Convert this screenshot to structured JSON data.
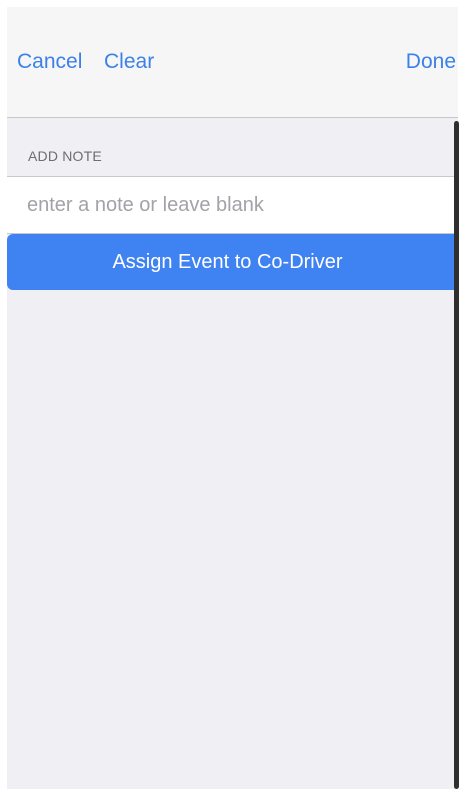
{
  "navbar": {
    "cancel_label": "Cancel",
    "clear_label": "Clear",
    "done_label": "Done"
  },
  "note_section": {
    "header": "ADD NOTE",
    "placeholder": "enter a note or leave blank",
    "value": ""
  },
  "assign_button": {
    "label": "Assign Event to Co-Driver"
  },
  "colors": {
    "accent": "#3b82e8",
    "button_bg": "#3f82f2",
    "background": "#efeff4",
    "navbar_bg": "#f6f6f6"
  }
}
